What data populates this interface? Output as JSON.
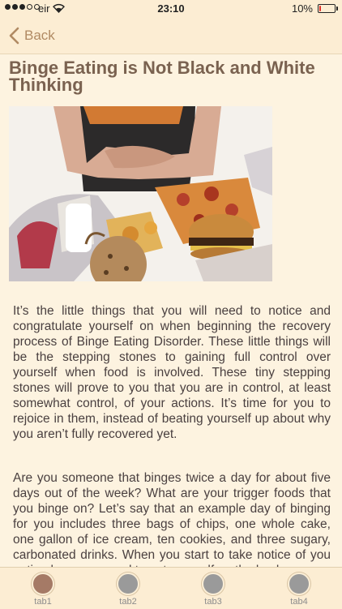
{
  "status": {
    "carrier": "eir",
    "time": "23:10",
    "battery_percent": "10%",
    "battery_level": 0.1,
    "battery_color": "#e0302a",
    "signal_bars_filled": 3,
    "signal_bars_total": 5
  },
  "nav": {
    "back_label": "Back",
    "accent_color": "#b08a63"
  },
  "article": {
    "title": "Binge Eating is Not Black and White Thinking",
    "paragraphs": [
      "It’s the little things that you will need to notice and congratulate yourself on when beginning the recovery process of Binge Eating Disorder.  These little things will be the stepping stones to gaining full control over yourself when food is involved.  These tiny stepping stones will prove to you that you are in control, at least somewhat control, of your actions.  It’s time for you to rejoice in them, instead of beating yourself up about why you aren’t fully recovered yet.",
      "Are you someone that binges twice a day for about five days out of the week?  What are your trigger foods that you binge on?  Let’s say that an example day of binging for you includes three bags of chips, one whole cake, one gallon of ice cream, ten cookies, and three sugary, carbonated drinks.  When you start to take notice of you eating less, you need to pat yourself on the back."
    ]
  },
  "tabs": [
    {
      "label": "tab1",
      "selected": true,
      "icon_color": "#a57a66"
    },
    {
      "label": "tab2",
      "selected": false,
      "icon_color": "#9a9a9a"
    },
    {
      "label": "tab3",
      "selected": false,
      "icon_color": "#9a9a9a"
    },
    {
      "label": "tab4",
      "selected": false,
      "icon_color": "#9a9a9a"
    }
  ]
}
